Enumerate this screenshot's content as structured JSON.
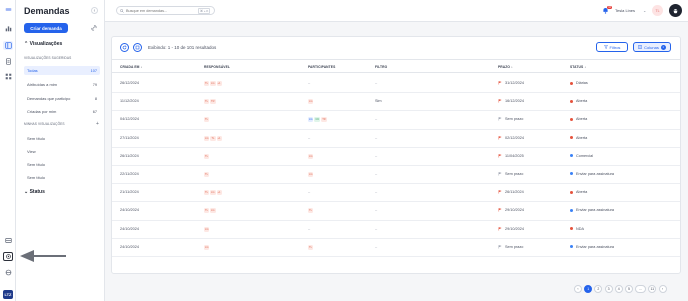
{
  "sidebar": {
    "title": "Demandas",
    "create_button": "Criar demanda",
    "visualizacoes_label": "Visualizações",
    "sugeridas_label": "VISUALIZAÇÕES SUGERIDAS",
    "suggested": [
      {
        "label": "Todas",
        "count": "107"
      },
      {
        "label": "Atribuídas a mim",
        "count": "79"
      },
      {
        "label": "Demandas que participo",
        "count": "8"
      },
      {
        "label": "Criadas por mim",
        "count": "67"
      }
    ],
    "minhas_label": "MINHAS VISUALIZAÇÕES",
    "minhas_add": "+",
    "mine": [
      "Sem título",
      "View",
      "Sem título",
      "Sem título"
    ],
    "status_label": "Status"
  },
  "topbar": {
    "search_placeholder": "Busque em demandas...",
    "search_shortcut": "⌘ + K",
    "notif_count": "10",
    "user_name": "Tesla Lines",
    "avatar_initials": "TL"
  },
  "toolbar": {
    "results_text": "Exibindo: 1 - 10 de 101 resultados",
    "filtros_label": "Filtros",
    "colunas_label": "Colunas"
  },
  "table": {
    "headers": {
      "created": "CRIADA EM",
      "responsavel": "RESPONSÁVEL",
      "participantes": "PARTICIPANTES",
      "filtro": "FILTRO",
      "prazo": "PRAZO",
      "status": "STATUS"
    },
    "rows": [
      {
        "created": "26/12/2024",
        "resp": [
          "TL",
          "LG",
          "+1"
        ],
        "part": "",
        "filtro": "",
        "prazo": "31/12/2024",
        "status": "Diárias",
        "status_color": "#e5533d"
      },
      {
        "created": "11/12/2024",
        "resp": [
          "TL",
          "TR"
        ],
        "part": "LG",
        "filtro": "Sim",
        "prazo": "16/12/2024",
        "status": "Aberta",
        "status_color": "#e5533d"
      },
      {
        "created": "04/12/2024",
        "resp": [
          "TL"
        ],
        "part": "LG CC TR",
        "filtro": "",
        "prazo": "Sem prazo",
        "status": "Aberta",
        "status_color": "#e5533d"
      },
      {
        "created": "27/11/2024",
        "resp": [
          "LG",
          "TL",
          "+1"
        ],
        "part": "",
        "filtro": "",
        "prazo": "02/12/2024",
        "status": "Aberta",
        "status_color": "#e5533d"
      },
      {
        "created": "26/11/2024",
        "resp": [
          "TL"
        ],
        "part": "LG",
        "filtro": "",
        "prazo": "11/04/2025",
        "status": "Comercial",
        "status_color": "#3b82f6"
      },
      {
        "created": "22/11/2024",
        "resp": [
          "TL"
        ],
        "part": "LG",
        "filtro": "",
        "prazo": "Sem prazo",
        "status": "Enviar para assinatura",
        "status_color": "#3b82f6"
      },
      {
        "created": "21/11/2024",
        "resp": [
          "TL",
          "LG",
          "+1"
        ],
        "part": "",
        "filtro": "",
        "prazo": "26/11/2024",
        "status": "Aberta",
        "status_color": "#e5533d"
      },
      {
        "created": "24/10/2024",
        "resp": [
          "TL",
          "LG"
        ],
        "part": "TL",
        "filtro": "",
        "prazo": "29/10/2024",
        "status": "Enviar para assinatura",
        "status_color": "#3b82f6"
      },
      {
        "created": "24/10/2024",
        "resp": [
          "LG"
        ],
        "part": "",
        "filtro": "",
        "prazo": "29/10/2024",
        "status": "NDA",
        "status_color": "#e5533d"
      },
      {
        "created": "24/10/2024",
        "resp": [
          "LG"
        ],
        "part": "TL",
        "filtro": "",
        "prazo": "Sem prazo",
        "status": "Enviar para assinatura",
        "status_color": "#3b82f6"
      }
    ]
  },
  "pagination": {
    "prev": "‹",
    "pages": [
      "1",
      "2",
      "3",
      "4",
      "5",
      "...",
      "11"
    ],
    "current": "1",
    "next": "›"
  },
  "rail": {
    "brand": "LTZ"
  },
  "colors": {
    "accent": "#2563eb",
    "danger": "#e5533d",
    "info": "#3b82f6"
  }
}
